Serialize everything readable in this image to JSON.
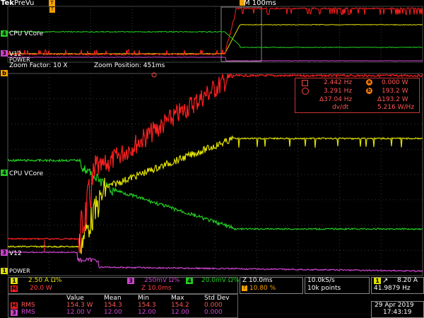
{
  "header": {
    "brand": "Tek",
    "mode": "PreVu",
    "trigger_pos": "T",
    "timebase": "M 100ms"
  },
  "zoom": {
    "factor_label": "Zoom Factor: 10 X",
    "position_label": "Zoom Position: 451ms"
  },
  "channels": {
    "cpu_vcore": "CPU VCore",
    "v12": "V12",
    "power": "POWER",
    "marker_b": "b",
    "marker_w": "W",
    "marker_1": "1",
    "marker_4": "4"
  },
  "colors": {
    "ch1": "#e0e000",
    "ch3": "#cc44cc",
    "ch4": "#22cc22",
    "math": "#ff2020",
    "bg": "#000000",
    "grid": "#505050"
  },
  "cursor_readout": {
    "a_freq": "2.442 Hz",
    "a_val": "0.000 W",
    "b_freq": "3.291 Hz",
    "b_val": "193.2 W",
    "delta_freq": "Δ37.04 Hz",
    "delta_val": "Δ193.2 W",
    "ddt_label": "dv/dt",
    "ddt_val": "5.216 W/Hz",
    "a_marker": "a",
    "b_marker": "b"
  },
  "settings": {
    "ch1": "2.50 A  Ω%",
    "ch3": "250mV Ω%",
    "ch4": "20.0mV Ω%",
    "math": "20.0 W",
    "zoom_time": "Z 10.0ms",
    "z_label": "Z 10.0ms",
    "trig_pos": "10.80 %",
    "sample_rate": "10.0kS/s",
    "record": "10k points",
    "trig_level": "8.20 A",
    "trig_freq": "41.9879 Hz",
    "ch1_num": "1",
    "ch3_num": "3",
    "ch4_num": "4",
    "m_num": "M",
    "t_num": "T"
  },
  "stats": {
    "headers": [
      "Value",
      "Mean",
      "Min",
      "Max",
      "Std Dev"
    ],
    "rows": [
      {
        "label": "RMS",
        "chip": "M",
        "cells": [
          "154.3 W",
          "154.3",
          "154.3",
          "154.2",
          "0.000"
        ]
      },
      {
        "label": "RMS",
        "chip": "3",
        "cells": [
          "12.00 V",
          "12.00",
          "12.00",
          "12.00",
          "0.000"
        ]
      }
    ]
  },
  "datetime": {
    "date": "29 Apr 2019",
    "time": "17:43:19"
  }
}
